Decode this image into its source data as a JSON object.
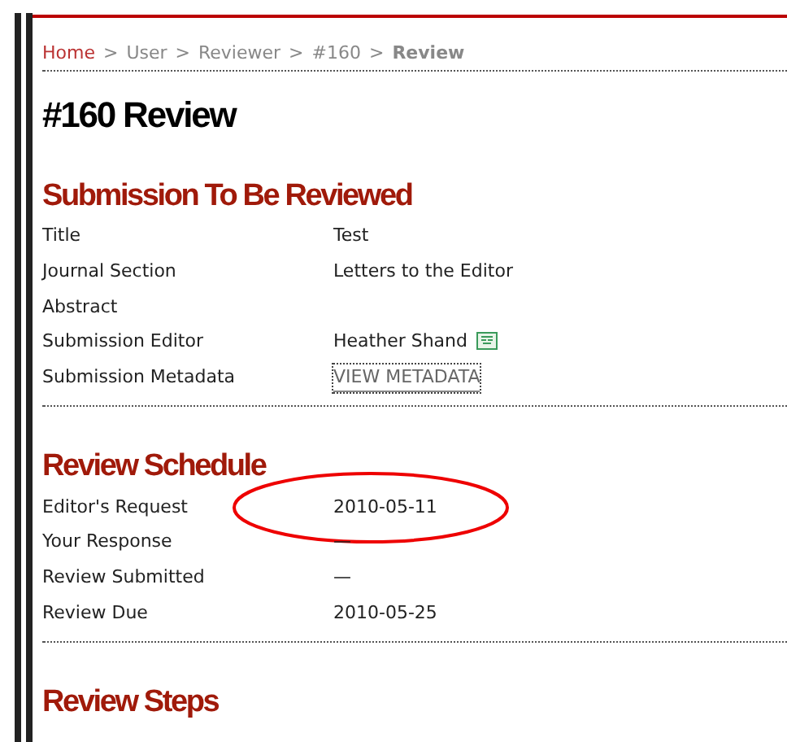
{
  "breadcrumb": [
    {
      "label": "Home",
      "kind": "link",
      "current": false
    },
    {
      "label": "User",
      "kind": "link",
      "current": false
    },
    {
      "label": "Reviewer",
      "kind": "link",
      "current": false
    },
    {
      "label": "#160",
      "kind": "link",
      "current": false
    },
    {
      "label": "Review",
      "kind": "link",
      "current": true
    }
  ],
  "breadcrumb_separator": ">",
  "page_title": "#160 Review",
  "sections": [
    {
      "heading": "Submission To Be Reviewed",
      "rows": [
        {
          "label": "Title",
          "value": "Test",
          "kind": "text",
          "circled": false
        },
        {
          "label": "Journal Section",
          "value": "Letters to the Editor",
          "kind": "text",
          "circled": false
        },
        {
          "label": "Abstract",
          "circled": false
        },
        {
          "label": "Submission Editor",
          "value": "Heather Shand",
          "kind": "email",
          "circled": false
        },
        {
          "label": "Submission Metadata",
          "value": "VIEW METADATA",
          "kind": "link",
          "circled": false
        }
      ]
    },
    {
      "heading": "Review Schedule",
      "rows": [
        {
          "label": "Editor's Request",
          "value": "2010-05-11",
          "kind": "text",
          "circled": true
        },
        {
          "label": "Your Response",
          "value": "—",
          "kind": "text",
          "circled": false
        },
        {
          "label": "Review Submitted",
          "value": "—",
          "kind": "text",
          "circled": false
        },
        {
          "label": "Review Due",
          "value": "2010-05-25",
          "kind": "text",
          "circled": false
        }
      ]
    },
    {
      "heading": "Review Steps"
    }
  ]
}
